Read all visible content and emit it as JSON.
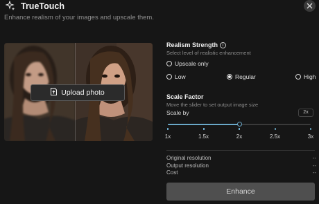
{
  "app": {
    "title": "TrueTouch",
    "subtitle": "Enhance realism of your images and upscale them."
  },
  "preview": {
    "upload_label": "Upload photo"
  },
  "realism": {
    "title": "Realism Strength",
    "description": "Select level of realistic enhancement",
    "upscale_only_label": "Upscale only",
    "levels": [
      {
        "label": "Low",
        "selected": false
      },
      {
        "label": "Regular",
        "selected": true
      },
      {
        "label": "High",
        "selected": false
      }
    ]
  },
  "scale": {
    "title": "Scale Factor",
    "description": "Move the slider to set output image size",
    "scale_by_label": "Scale by",
    "value_badge": "2x",
    "ticks": [
      "1x",
      "1.5x",
      "2x",
      "2.5x",
      "3x"
    ],
    "selected_index": 2
  },
  "summary": {
    "original_label": "Original resolution",
    "original_value": "--",
    "output_label": "Output resolution",
    "output_value": "--",
    "cost_label": "Cost",
    "cost_value": "--"
  },
  "actions": {
    "enhance_label": "Enhance"
  },
  "colors": {
    "accent": "#6aa8c8",
    "background": "#161616",
    "button_disabled": "#4f4f4f"
  }
}
